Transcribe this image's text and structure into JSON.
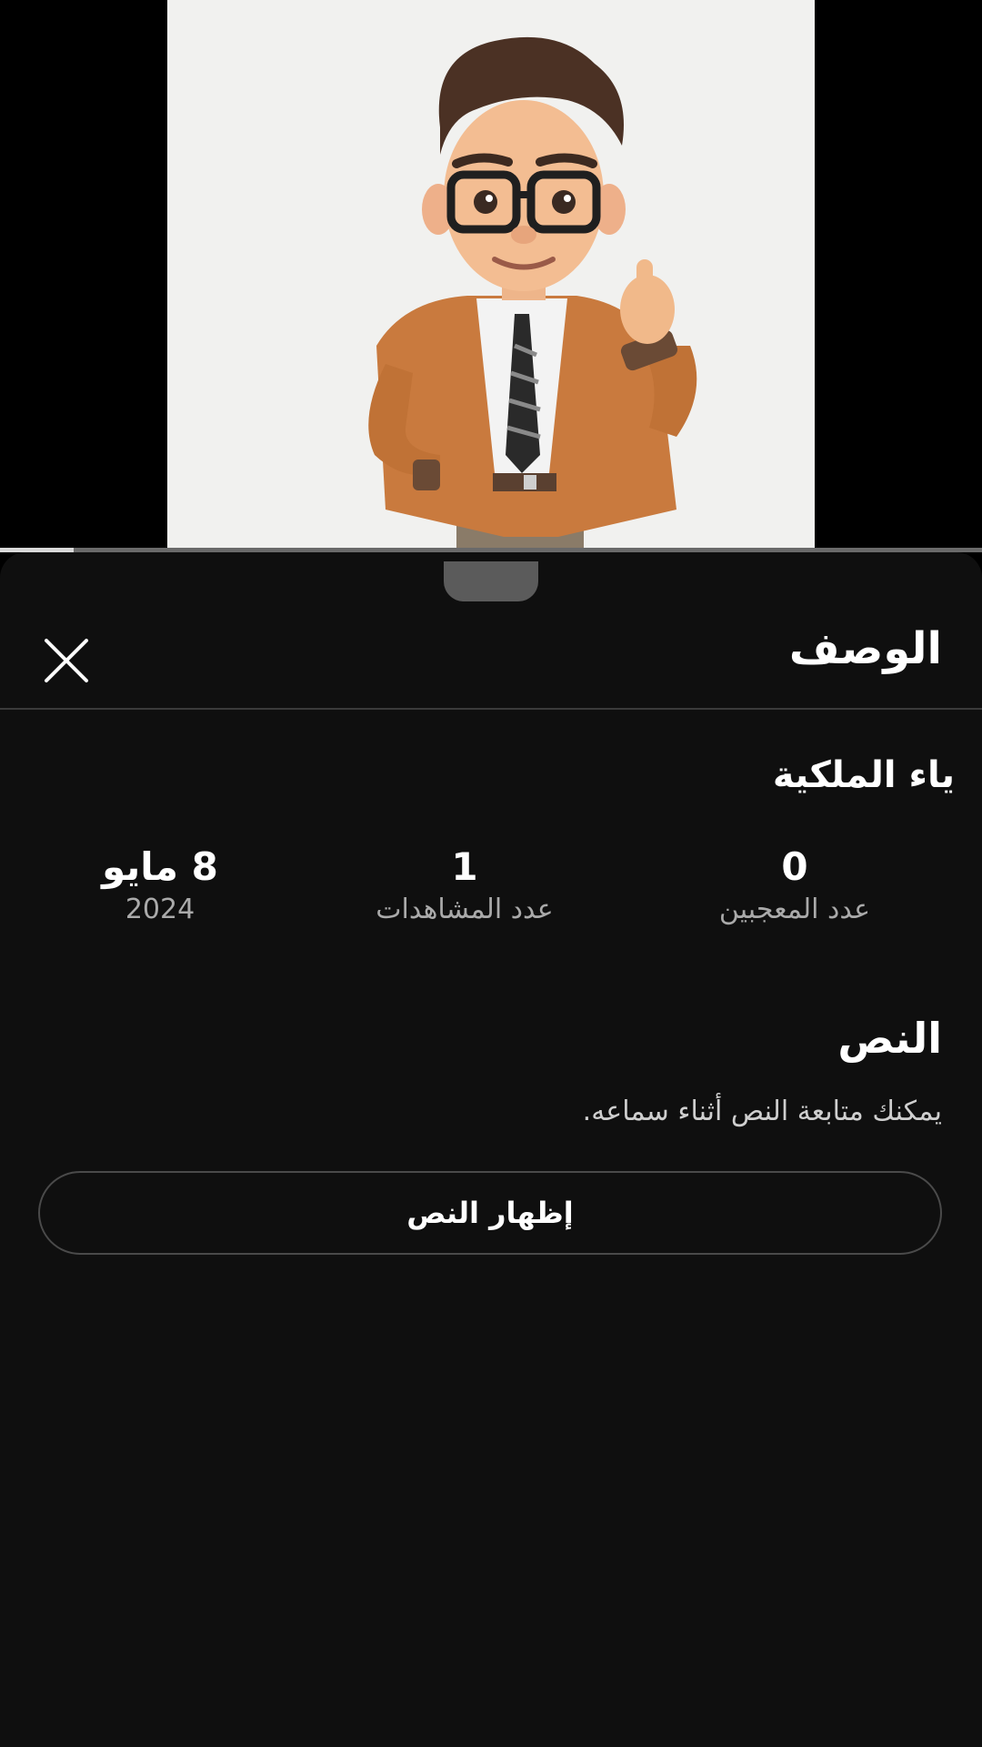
{
  "video": {
    "progress_fraction": 0.075
  },
  "sheet": {
    "title": "الوصف",
    "close_icon": "close-icon",
    "video_title": "ياء الملكية",
    "stats": [
      {
        "value": "0",
        "label": "عدد المعجبين"
      },
      {
        "value": "1",
        "label": "عدد المشاهدات"
      },
      {
        "value": "8 مايو",
        "label": "2024"
      }
    ],
    "transcript": {
      "title": "النص",
      "description": "يمكنك متابعة النص أثناء سماعه.",
      "button_label": "إظهار النص"
    }
  }
}
